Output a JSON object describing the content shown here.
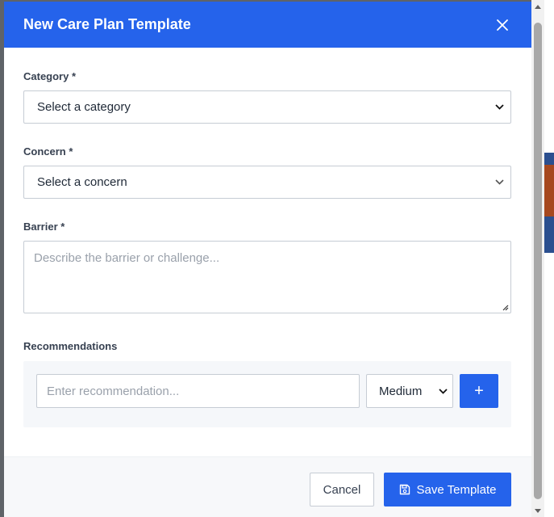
{
  "modal": {
    "title": "New Care Plan Template",
    "close_icon": "close-icon",
    "accent_color": "#2563eb"
  },
  "fields": {
    "category": {
      "label": "Category *",
      "selected": "Select a category"
    },
    "concern": {
      "label": "Concern *",
      "selected": "Select a concern"
    },
    "barrier": {
      "label": "Barrier *",
      "placeholder": "Describe the barrier or challenge..."
    },
    "recommendations": {
      "label": "Recommendations",
      "input_placeholder": "Enter recommendation...",
      "priority_selected": "Medium",
      "add_label": "+"
    }
  },
  "footer": {
    "cancel_label": "Cancel",
    "save_label": "Save Template",
    "save_icon": "save-icon"
  }
}
